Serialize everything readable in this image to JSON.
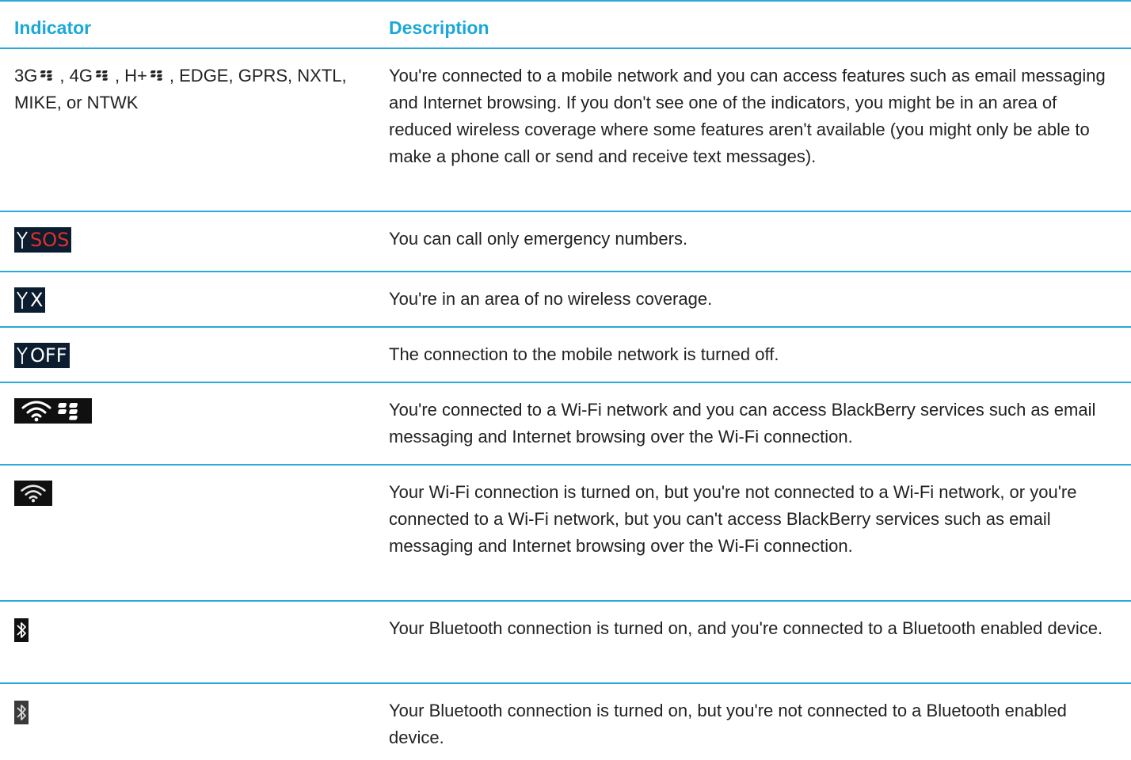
{
  "table": {
    "header": {
      "indicator": "Indicator",
      "description": "Description"
    },
    "rows": [
      {
        "indicator_parts": [
          "3G",
          ", 4G",
          ", H+",
          ", EDGE, GPRS, NXTL, MIKE, or NTWK"
        ],
        "description": "You're connected to a mobile network and you can access features such as email messaging and Internet browsing. If you don't see one of the indicators, you might be in an area of reduced wireless coverage where some features aren't available (you might only be able to make a phone call or send and receive text messages)."
      },
      {
        "indicator_label": "SOS",
        "description": "You can call only emergency numbers."
      },
      {
        "indicator_label": "X",
        "description": "You're in an area of no wireless coverage."
      },
      {
        "indicator_label": "OFF",
        "description": "The connection to the mobile network is turned off."
      },
      {
        "icon": "wifi-blackberry-icon",
        "description": "You're connected to a Wi-Fi network and you can access BlackBerry services such as email messaging and Internet browsing over the Wi-Fi connection."
      },
      {
        "icon": "wifi-icon",
        "description": "Your Wi-Fi connection is turned on, but you're not connected to a Wi-Fi network, or you're connected to a Wi-Fi network, but you can't access BlackBerry services such as email messaging and Internet browsing over the Wi-Fi connection."
      },
      {
        "icon": "bluetooth-connected-icon",
        "description": "Your Bluetooth connection is turned on, and you're connected to a Bluetooth enabled device."
      },
      {
        "icon": "bluetooth-on-icon",
        "description": "Your Bluetooth connection is turned on, but you're not connected to a Bluetooth enabled device."
      }
    ]
  },
  "colors": {
    "rule": "#2aa9da",
    "header_text": "#1aa7d9",
    "body_text": "#222222",
    "icon_background": "#0c1d2f",
    "sos_red": "#e0302c"
  }
}
